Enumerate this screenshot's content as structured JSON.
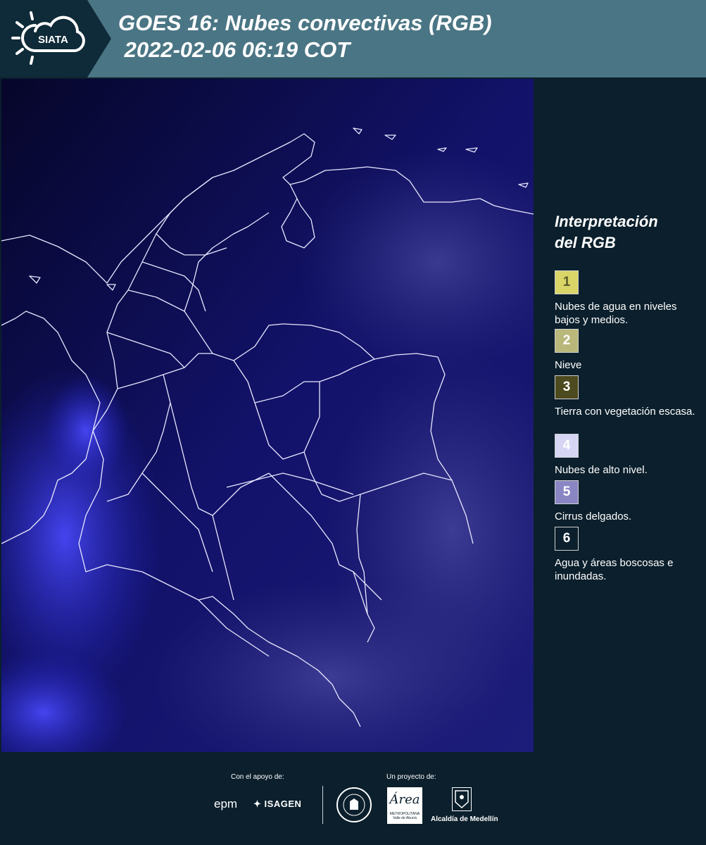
{
  "header": {
    "logo_text": "SIATA",
    "title_line1": "GOES 16: Nubes convectivas (RGB)",
    "title_line2": " 2022-02-06 06:19 COT"
  },
  "legend": {
    "title_line1": "Interpretación",
    "title_line2": "del RGB",
    "items": [
      {
        "number": "1",
        "label": "Nubes de agua en niveles bajos y medios.",
        "color": "#d9d567",
        "text_color": "#5a5a2a"
      },
      {
        "number": "2",
        "label": "Nieve",
        "color": "#b9b77a",
        "text_color": "#ffffff"
      },
      {
        "number": "3",
        "label": "Tierra con vegetación escasa.",
        "color": "#4c4a1e",
        "text_color": "#ffffff"
      },
      {
        "number": "4",
        "label": "Nubes de alto nivel.",
        "color": "#d6d6f4",
        "text_color": "#ffffff"
      },
      {
        "number": "5",
        "label": "Cirrus delgados.",
        "color": "#8a86c4",
        "text_color": "#ffffff"
      },
      {
        "number": "6",
        "label": "Agua y áreas boscosas e inundadas.",
        "color": "#0b1f2c",
        "text_color": "#ffffff"
      }
    ]
  },
  "footer": {
    "support_label": "Con el apoyo de:",
    "project_label": "Un proyecto de:",
    "sponsor_epm": "epm",
    "sponsor_isagen": "ISAGEN",
    "area_logo_text": "Área",
    "area_logo_sub": "METROPOLITANA Valle de Aburrá",
    "alcaldia_label": "Alcaldía de Medellín"
  },
  "colors": {
    "header_bg": "#4a7584",
    "header_dark": "#0f2a38",
    "page_bg": "#0b1f2c",
    "map_bg": "#0a0a3a",
    "map_highlight": "#3f3fff"
  }
}
